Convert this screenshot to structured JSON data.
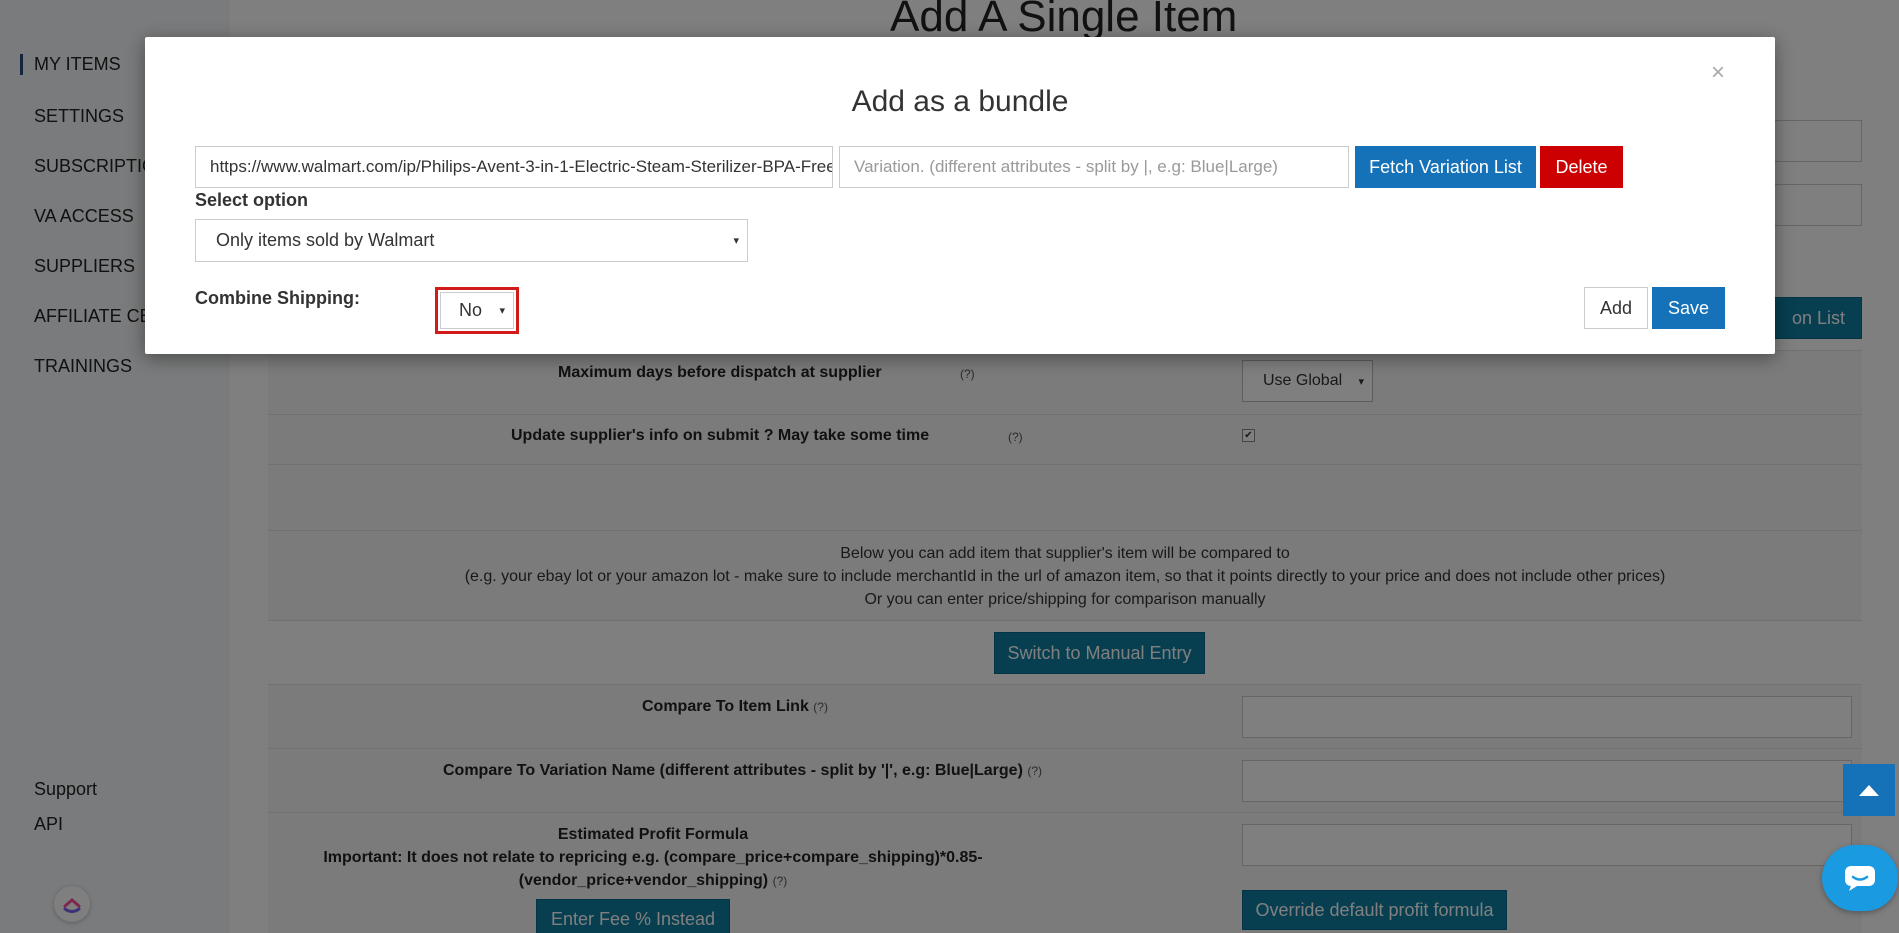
{
  "sidebar": {
    "items": [
      {
        "label": "MY ITEMS"
      },
      {
        "label": "SETTINGS"
      },
      {
        "label": "SUBSCRIPTIONS"
      },
      {
        "label": "VA ACCESS"
      },
      {
        "label": "SUPPLIERS"
      },
      {
        "label": "AFFILIATE CENTER"
      },
      {
        "label": "TRAININGS"
      }
    ],
    "support": "Support",
    "api": "API"
  },
  "page": {
    "title": "Add A Single Item",
    "max_days_label": "Maximum days before dispatch at supplier",
    "max_days_value": "Use Global",
    "update_info_label": "Update supplier's info on submit ? May take some time",
    "help": "(?)",
    "compare_info": [
      "Below you can add item that supplier's item will be compared to",
      "(e.g. your ebay lot or your amazon lot - make sure to include merchantId in the url of amazon item, so that it points directly to your price and does not include other prices)",
      "Or you can enter price/shipping for comparison manually"
    ],
    "switch_manual": "Switch to Manual Entry",
    "compare_link_label": "Compare To Item Link",
    "compare_variation_label": "Compare To Variation Name (different attributes - split by '|', e.g: Blue|Large)",
    "profit_formula_title": "Estimated Profit Formula",
    "profit_formula_note_1": "Important: It does not relate to repricing e.g. (compare_price+compare_shipping)*0.85-",
    "profit_formula_note_2": "(vendor_price+vendor_shipping)",
    "enter_fee": "Enter Fee % Instead",
    "override_formula": "Override default profit formula",
    "partial_button": "on List"
  },
  "modal": {
    "title": "Add as a bundle",
    "close": "×",
    "url_value": "https://www.walmart.com/ip/Philips-Avent-3-in-1-Electric-Steam-Sterilizer-BPA-Free",
    "variation_placeholder": "Variation. (different attributes - split by |, e.g: Blue|Large)",
    "fetch_label": "Fetch Variation List",
    "delete_label": "Delete",
    "select_option_label": "Select option",
    "select_option_value": "Only items sold by Walmart",
    "combine_label": "Combine Shipping:",
    "combine_value": "No",
    "add_label": "Add",
    "save_label": "Save"
  },
  "colors": {
    "primary": "#1672b8",
    "danger": "#cc0000",
    "teal": "#0e7fa3",
    "highlight": "#d21a1a"
  }
}
